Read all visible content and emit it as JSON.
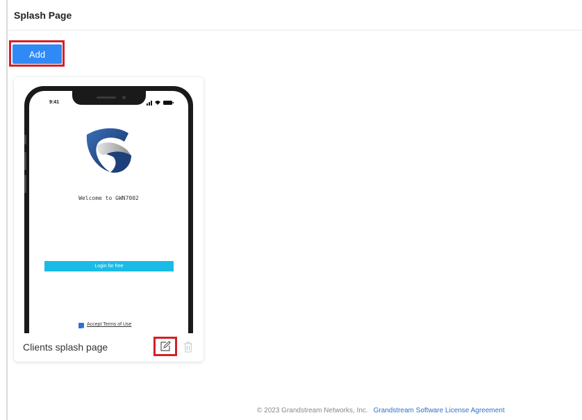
{
  "header": {
    "title": "Splash Page"
  },
  "toolbar": {
    "add_label": "Add"
  },
  "card": {
    "name": "Clients splash page",
    "preview": {
      "status_time": "9:41",
      "welcome": "Welcome to GWN7002",
      "login_button": "Login for free",
      "terms_label": "Accept Terms of Use"
    },
    "actions": {
      "edit_icon": "edit-icon",
      "delete_icon": "trash-icon"
    }
  },
  "footer": {
    "copyright": "© 2023 Grandstream Networks, Inc.",
    "license_link": "Grandstream Software License Agreement"
  },
  "colors": {
    "primary": "#2f8af5",
    "highlight": "#d32027",
    "login_button": "#1abbe6",
    "link": "#2f6fc6"
  }
}
